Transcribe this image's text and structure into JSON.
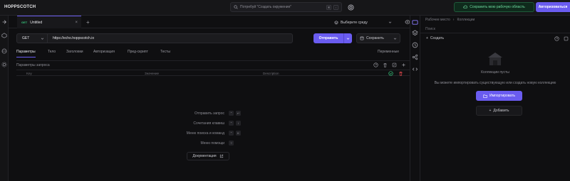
{
  "app": {
    "logo": "HOPPSCOTCH"
  },
  "search": {
    "placeholder": "Потребуй \"Создать окружение\"",
    "key": "/"
  },
  "topbar": {
    "save_workspace": "Сохранить мою рабочую область",
    "login": "Авторизоваться"
  },
  "tab": {
    "method": "GET",
    "title": "Untitled"
  },
  "env": {
    "label": "Выберите среду"
  },
  "request": {
    "method": "GET",
    "url": "https://echo.hoppscotch.io",
    "send": "Отправить",
    "save": "Сохранить"
  },
  "reqtabs": [
    "Параметры",
    "Тело",
    "Заголовки",
    "Авторизация",
    "Пред-скрипт",
    "Тесты"
  ],
  "variables": "Переменные",
  "params": {
    "title": "Параметры запроса",
    "cols": [
      "Key",
      "Значение",
      "Description"
    ]
  },
  "shortcuts": [
    {
      "label": "Отправить запрос",
      "keys": [
        "⌃",
        "↵"
      ]
    },
    {
      "label": "Сочетания клавиш",
      "keys": [
        "⌃",
        "/"
      ]
    },
    {
      "label": "Меню поиска и команд",
      "keys": [
        "⌃",
        "K"
      ]
    },
    {
      "label": "Меню помощи",
      "keys": [
        "?"
      ]
    }
  ],
  "docs": "Документация",
  "right": {
    "crumb": [
      "Рабочее место",
      "Коллекции"
    ],
    "search": "Поиск",
    "create": "Создать",
    "empty": "Коллекции пусты",
    "hint": "Вы можете импортировать существующую или создать новую коллекцию",
    "import": "Импортировать",
    "add": "Добавить"
  },
  "colors": {
    "accent": "#6a5cf0",
    "green": "#35c37a",
    "bg": "#0f0f11"
  }
}
